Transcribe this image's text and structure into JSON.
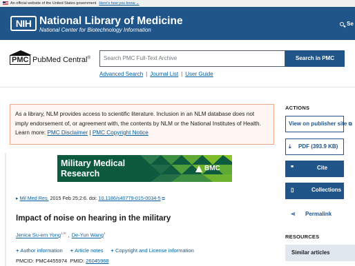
{
  "gov_banner": {
    "text": "An official website of the United States government",
    "link": "Here's how you know",
    "chevron": "⌄"
  },
  "header": {
    "logo": "NIH",
    "title": "National Library of Medicine",
    "subtitle": "National Center for Biotechnology Information",
    "search_label": "Se"
  },
  "pmc": {
    "logo_box": "PMC",
    "logo_text": "PubMed Central",
    "logo_reg": "®",
    "search_placeholder": "Search PMC Full-Text Archive",
    "search_button": "Search in PMC",
    "links": [
      "Advanced Search",
      "Journal List",
      "User Guide"
    ]
  },
  "disclaimer": {
    "text": "As a library, NLM provides access to scientific literature. Inclusion in an NLM database does not imply endorsement of, or agreement with, the contents by NLM or the National Institutes of Health. Learn more:",
    "link1": "PMC Disclaimer",
    "separator": "|",
    "link2": "PMC Copyright Notice"
  },
  "ad": {
    "line1": "Military Medical",
    "line2": "Research",
    "brand": "BMC"
  },
  "article": {
    "journal": "Mil Med Res.",
    "date_text": " 2015 Feb 25;2:6. doi: ",
    "doi": "10.1186/s40779-015-0034-5",
    "title": "Impact of noise on hearing in the military",
    "author1": "Jenica Su-ern Yong",
    "author1_sup": "1,✉",
    "author_sep": ",",
    "author2": "De-Yun Wang",
    "author2_sup": "1",
    "meta_links": [
      "Author information",
      "Article notes",
      "Copyright and License information"
    ],
    "pmcid_label": "PMCID: PMC4455974",
    "pmid_label": "PMID:",
    "pmid": "26045968"
  },
  "sidebar": {
    "actions_heading": "ACTIONS",
    "view_publisher": "View on publisher site",
    "pdf": "PDF (393.9 KB)",
    "cite": "Cite",
    "collections": "Collections",
    "permalink": "Permalink",
    "resources_heading": "RESOURCES",
    "similar_articles": "Similar articles"
  },
  "colors": {
    "header_bg": "#20558a",
    "link": "#005ea2",
    "ad_bg": "#0d5a3f",
    "disclaimer_bg": "#fef6f2"
  }
}
